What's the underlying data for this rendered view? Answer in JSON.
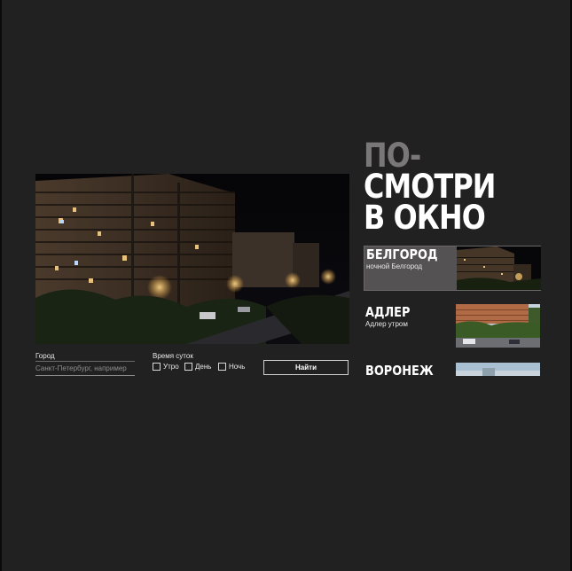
{
  "title": {
    "line1": "ПО-",
    "line2": "СМОТРИ",
    "line3": "В ОКНО"
  },
  "form": {
    "city_label": "Город",
    "city_placeholder": "Санкт-Петербург, например",
    "time_label": "Время суток",
    "options": [
      "Утро",
      "День",
      "Ночь"
    ],
    "search_button": "Найти"
  },
  "cities": [
    {
      "name": "БЕЛГОРОД",
      "caption": "ночной Белгород"
    },
    {
      "name": "АДЛЕР",
      "caption": "Адлер утром"
    },
    {
      "name": "ВОРОНЕЖ",
      "caption": ""
    }
  ],
  "colors": {
    "background": "#222122",
    "active_card": "#545253",
    "title_muted": "#7a7778"
  }
}
